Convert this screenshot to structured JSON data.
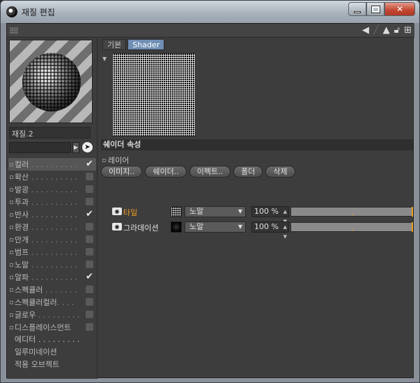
{
  "window": {
    "title": "재질 편집"
  },
  "left": {
    "material_name": "재질.2",
    "search_placeholder": "",
    "channels": [
      {
        "label": "컬러",
        "dots": " . . . . . . . . . .",
        "checked": true,
        "active": true
      },
      {
        "label": "확산",
        "dots": " . . . . . . . . . .",
        "checked": false
      },
      {
        "label": "발광",
        "dots": " . . . . . . . . . .",
        "checked": false
      },
      {
        "label": "투과",
        "dots": " . . . . . . . . . .",
        "checked": false
      },
      {
        "label": "반사",
        "dots": " . . . . . . . . . .",
        "checked": true
      },
      {
        "label": "환경",
        "dots": " . . . . . . . . . .",
        "checked": false
      },
      {
        "label": "안개",
        "dots": " . . . . . . . . . .",
        "checked": false
      },
      {
        "label": "범프",
        "dots": " . . . . . . . . . .",
        "checked": false
      },
      {
        "label": "노말",
        "dots": " . . . . . . . . . .",
        "checked": false
      },
      {
        "label": "알파",
        "dots": " . . . . . . . . . .",
        "checked": true
      },
      {
        "label": "스펙큘러",
        "dots": " . . . . . . .",
        "checked": false
      },
      {
        "label": "스펙큘러컬러",
        "dots": ". . . .",
        "checked": false
      },
      {
        "label": "글로우",
        "dots": " . . . . . . . . .",
        "checked": false
      },
      {
        "label": "디스플레이스먼트",
        "dots": "",
        "checked": false
      }
    ],
    "extra": [
      "에디터 . . . . . . . . .",
      "일루미네이션",
      "적용 오브젝트"
    ]
  },
  "tabs": [
    "기본",
    "Shader"
  ],
  "section_title": "쉐이더 속성",
  "layer_label": "레이어",
  "buttons": [
    "이미지..",
    "쉐이더..",
    "이펙트..",
    "폴더",
    "삭제"
  ],
  "layers": [
    {
      "name": "타일",
      "blend": "노말",
      "opacity": "100 %",
      "opacity_value": 100,
      "selected": true,
      "thumb": "tile"
    },
    {
      "name": "그라데이션",
      "blend": "노말",
      "opacity": "100 %",
      "opacity_value": 100,
      "selected": false,
      "thumb": "grad"
    }
  ],
  "icons": {
    "toolbar": [
      "back-arrow-icon",
      "forward-arrow-icon",
      "up-arrow-icon",
      "lock-icon",
      "new-window-icon"
    ]
  }
}
